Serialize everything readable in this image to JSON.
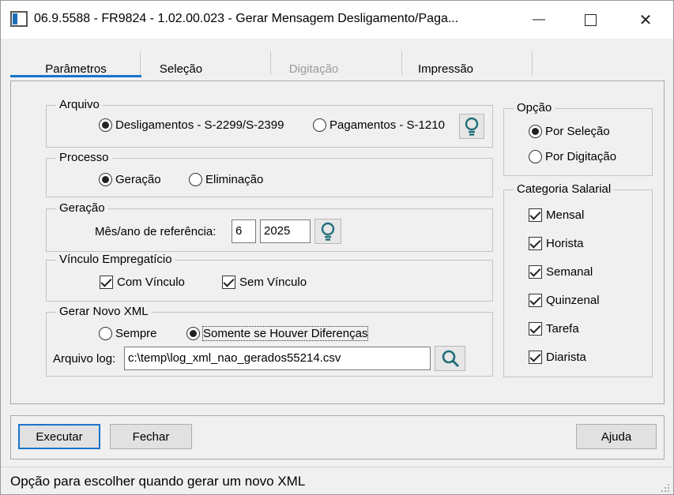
{
  "window": {
    "title": "06.9.5588 - FR9824 - 1.02.00.023 - Gerar Mensagem Desligamento/Paga...",
    "minimize_glyph": "—",
    "maximize_glyph": "☐",
    "close_glyph": "✕"
  },
  "tabs": [
    {
      "label": "Parâmetros",
      "state": "active"
    },
    {
      "label": "Seleção",
      "state": "normal"
    },
    {
      "label": "Digitação",
      "state": "disabled"
    },
    {
      "label": "Impressão",
      "state": "normal"
    }
  ],
  "arquivo": {
    "legend": "Arquivo",
    "options": [
      {
        "label": "Desligamentos - S-2299/S-2399",
        "selected": true
      },
      {
        "label": "Pagamentos - S-1210",
        "selected": false
      }
    ],
    "help_icon": "lightbulb-icon"
  },
  "processo": {
    "legend": "Processo",
    "options": [
      {
        "label": "Geração",
        "selected": true
      },
      {
        "label": "Eliminação",
        "selected": false
      }
    ]
  },
  "geracao": {
    "legend": "Geração",
    "ref_label": "Mês/ano de referência:",
    "month": "6",
    "year": "2025",
    "help_icon": "lightbulb-icon"
  },
  "vinculo": {
    "legend": "Vínculo Empregatício",
    "options": [
      {
        "label": "Com Vínculo",
        "checked": true
      },
      {
        "label": "Sem Vínculo",
        "checked": true
      }
    ]
  },
  "xml": {
    "legend": "Gerar Novo XML",
    "options": [
      {
        "label": "Sempre",
        "selected": false
      },
      {
        "label": "Somente se Houver Diferenças",
        "selected": true
      }
    ],
    "log_label": "Arquivo log:",
    "log_value": "c:\\temp\\log_xml_nao_gerados55214.csv",
    "search_icon": "magnifier-icon"
  },
  "opcao": {
    "legend": "Opção",
    "options": [
      {
        "label": "Por Seleção",
        "selected": true
      },
      {
        "label": "Por Digitação",
        "selected": false
      }
    ]
  },
  "categoria": {
    "legend": "Categoria Salarial",
    "options": [
      {
        "label": "Mensal",
        "checked": true
      },
      {
        "label": "Horista",
        "checked": true
      },
      {
        "label": "Semanal",
        "checked": true
      },
      {
        "label": "Quinzenal",
        "checked": true
      },
      {
        "label": "Tarefa",
        "checked": true
      },
      {
        "label": "Diarista",
        "checked": true
      }
    ]
  },
  "buttons": {
    "execute": "Executar",
    "close": "Fechar",
    "help": "Ajuda"
  },
  "status": {
    "text": "Opção para escolher quando gerar um novo XML"
  },
  "colors": {
    "accent": "#1a73c9",
    "icon_teal": "#1f6f79"
  }
}
